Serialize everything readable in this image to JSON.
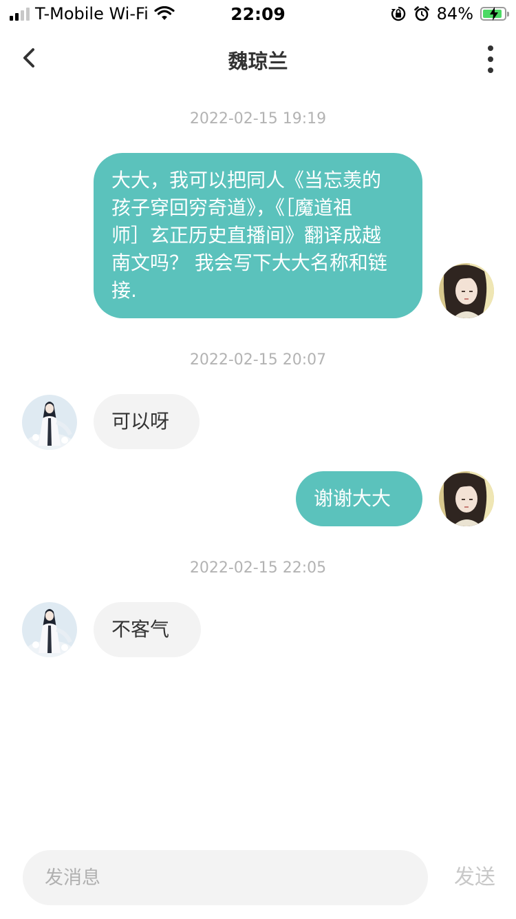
{
  "status_bar": {
    "carrier": "T-Mobile Wi-Fi",
    "time": "22:09",
    "battery_percent": "84%",
    "battery_level": 0.84,
    "icons": [
      "signal-icon",
      "wifi-icon",
      "orientation-lock-icon",
      "alarm-icon",
      "battery-charging-icon"
    ]
  },
  "nav": {
    "title": "魏琼兰",
    "back_icon": "chevron-left-icon",
    "more_icon": "more-vertical-icon"
  },
  "messages": [
    {
      "type": "timestamp",
      "text": "2022-02-15 19:19"
    },
    {
      "type": "outgoing",
      "lines": [
        "大大，我可以把同人《当忘羡的",
        "孩子穿回穷奇道》，《［魔道祖",
        "师］玄正历史直播间》翻译成越",
        "南文吗？ 我会写下大大名称和链",
        "接."
      ]
    },
    {
      "type": "timestamp",
      "text": "2022-02-15 20:07"
    },
    {
      "type": "incoming",
      "text": "可以呀"
    },
    {
      "type": "outgoing",
      "text": "谢谢大大"
    },
    {
      "type": "timestamp",
      "text": "2022-02-15 22:05"
    },
    {
      "type": "incoming",
      "text": "不客气"
    }
  ],
  "composer": {
    "placeholder": "发消息",
    "send_label": "发送"
  },
  "colors": {
    "outgoing_bubble": "#5bc2bc",
    "incoming_bubble": "#f3f3f3",
    "timestamp": "#b3b3b3",
    "send_disabled": "#c8c8c8"
  }
}
